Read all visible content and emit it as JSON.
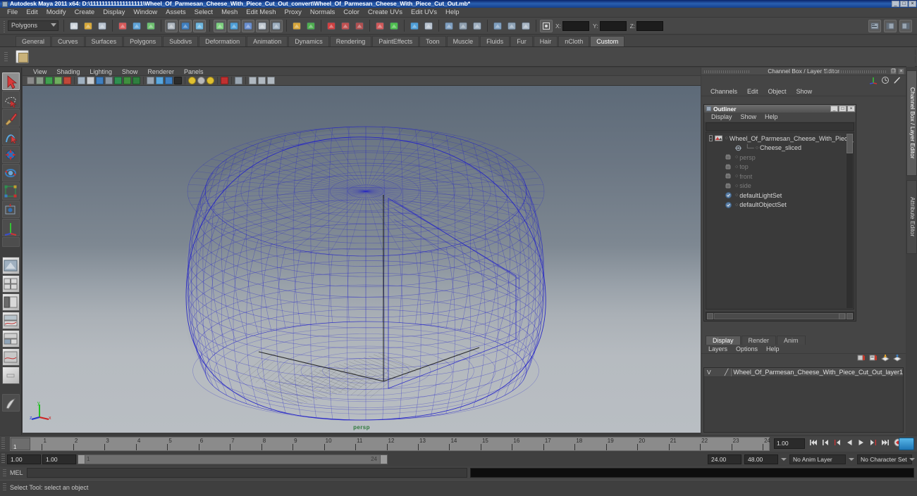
{
  "window": {
    "title": "Autodesk Maya 2011 x64: D:\\111111111111111111\\Wheel_Of_Parmesan_Cheese_With_Piece_Cut_Out_convert\\Wheel_Of_Parmesan_Cheese_With_Piece_Cut_Out.mb*",
    "buttons": [
      "_",
      "□",
      "×"
    ]
  },
  "menubar": {
    "items": [
      "File",
      "Edit",
      "Modify",
      "Create",
      "Display",
      "Window",
      "Assets",
      "Select",
      "Mesh",
      "Edit Mesh",
      "Proxy",
      "Normals",
      "Color",
      "Create UVs",
      "Edit UVs",
      "Help"
    ]
  },
  "toolbar": {
    "mode_menu": "Polygons",
    "coord_labels": [
      "X:",
      "Y:",
      "Z:"
    ],
    "coord_values": [
      "",
      "",
      ""
    ],
    "icons": [
      "new-scene-icon",
      "open-scene-icon",
      "save-scene-icon",
      "undo-icon",
      "redo-icon",
      "redo-all-icon",
      "select-hierarchy-icon",
      "select-by-object-icon",
      "select-by-component-icon",
      "snap-grid-icon",
      "snap-curve-icon",
      "snap-point-icon",
      "snap-view-plane-icon",
      "construction-plane-icon",
      "make-live-icon",
      "render-view-icon",
      "render-current-frame-icon",
      "ipr-render-icon",
      "render-settings-icon",
      "lock-icon",
      "highlight-icon",
      "select-handle-icon",
      "show-manipulator-icon",
      "input-connections-icon",
      "output-connections-icon",
      "no-connections-icon",
      "attribute-editor-icon",
      "channel-box-icon",
      "tool-settings-icon"
    ]
  },
  "shelf": {
    "tabs": [
      "General",
      "Curves",
      "Surfaces",
      "Polygons",
      "Subdivs",
      "Deformation",
      "Animation",
      "Dynamics",
      "Rendering",
      "PaintEffects",
      "Toon",
      "Muscle",
      "Fluids",
      "Fur",
      "Hair",
      "nCloth",
      "Custom"
    ],
    "active_tab": "Custom"
  },
  "viewport": {
    "menu": [
      "View",
      "Shading",
      "Lighting",
      "Show",
      "Renderer",
      "Panels"
    ],
    "camera_label": "persp",
    "axis_labels": {
      "x": "x",
      "y": "y",
      "z": "z"
    },
    "toolbar_icons": [
      "select-camera-icon",
      "lock-camera-icon",
      "image-plane-icon",
      "bookmark-icon",
      "exposure-icon",
      "wireframe-icon",
      "smooth-shade-all-icon",
      "smooth-shade-selected-icon",
      "flat-shade-icon",
      "shaded-wireframe-icon",
      "textured-icon",
      "lighting-icon",
      "use-default-light-icon",
      "use-all-lights-icon",
      "shadows-icon",
      "occlusion-icon",
      "light1-icon",
      "light2-icon",
      "light3-icon",
      "xray-icon",
      "isolate-select-icon",
      "grid-icon",
      "panel-layout-icon",
      "hud-icon"
    ]
  },
  "toolbox": {
    "tools": [
      "select-tool",
      "lasso-select-tool",
      "paint-select-tool",
      "soft-select-tool",
      "move-tool",
      "rotate-tool",
      "scale-tool",
      "universal-manipulator-tool",
      "show-manipulator-tool",
      "last-tool-used",
      "layout-single-perspective",
      "layout-four-view",
      "layout-persp-outliner",
      "layout-persp-graph",
      "layout-persp-hypershade",
      "layout-two-pane",
      "layout-custom",
      "paint-effects-tool"
    ]
  },
  "channel_box": {
    "title": "Channel Box / Layer Editor",
    "title_buttons": [
      "❐",
      "×"
    ],
    "menu": [
      "Channels",
      "Edit",
      "Object",
      "Show"
    ],
    "right_icons": [
      "show-manipulators-icon",
      "clock-icon",
      "pencil-icon"
    ]
  },
  "outliner": {
    "title": "Outliner",
    "title_buttons": [
      "_",
      "□",
      "×"
    ],
    "menu": [
      "Display",
      "Show",
      "Help"
    ],
    "search_value": "",
    "items": [
      {
        "label": "Wheel_Of_Parmesan_Cheese_With_Piece_Cut_O",
        "icon": "transform-node-icon",
        "indent": 0,
        "dim": false,
        "expandable": true
      },
      {
        "label": "Cheese_sliced",
        "icon": "mesh-node-icon",
        "indent": 1,
        "dim": false,
        "expandable": false
      },
      {
        "label": "persp",
        "icon": "camera-icon",
        "indent": 0,
        "dim": true,
        "expandable": false
      },
      {
        "label": "top",
        "icon": "camera-icon",
        "indent": 0,
        "dim": true,
        "expandable": false
      },
      {
        "label": "front",
        "icon": "camera-icon",
        "indent": 0,
        "dim": true,
        "expandable": false
      },
      {
        "label": "side",
        "icon": "camera-icon",
        "indent": 0,
        "dim": true,
        "expandable": false
      },
      {
        "label": "defaultLightSet",
        "icon": "set-icon",
        "indent": 0,
        "dim": false,
        "expandable": false
      },
      {
        "label": "defaultObjectSet",
        "icon": "set-icon",
        "indent": 0,
        "dim": false,
        "expandable": false
      }
    ]
  },
  "layer_editor": {
    "tabs": [
      "Display",
      "Render",
      "Anim"
    ],
    "active_tab": "Display",
    "menu": [
      "Layers",
      "Options",
      "Help"
    ],
    "toolbar_icons": [
      "new-layer-icon",
      "new-layer-from-selected-icon",
      "layer-up-icon",
      "layer-down-icon"
    ],
    "layers": [
      {
        "visibility": "V",
        "type": "",
        "name": "Wheel_Of_Parmesan_Cheese_With_Piece_Cut_Out_layer1"
      }
    ]
  },
  "right_tabs": {
    "items": [
      "Channel Box / Layer Editor",
      "Attribute Editor"
    ],
    "active": "Channel Box / Layer Editor"
  },
  "time_slider": {
    "ticks": [
      "1",
      "2",
      "3",
      "4",
      "5",
      "6",
      "7",
      "8",
      "9",
      "10",
      "11",
      "12",
      "13",
      "14",
      "15",
      "16",
      "17",
      "18",
      "19",
      "20",
      "21",
      "22",
      "23",
      "24"
    ],
    "current_frame": "1",
    "current_field": "1.00",
    "playback_buttons": [
      "go-to-start-icon",
      "step-back-frame-icon",
      "step-back-key-icon",
      "play-backwards-icon",
      "play-forwards-icon",
      "step-forward-key-icon",
      "go-to-end-icon",
      "auto-key-icon"
    ]
  },
  "range_slider": {
    "anim_start": "1.00",
    "range_start": "1.00",
    "range_bar_start": "1",
    "range_bar_end": "24",
    "range_end": "24.00",
    "anim_end": "48.00",
    "anim_layer": "No Anim Layer",
    "character_set": "No Character Set"
  },
  "command_line": {
    "label": "MEL",
    "input_value": "",
    "output_value": ""
  },
  "status_line": {
    "text": "Select Tool: select an object"
  },
  "colors": {
    "title_bar": "#1b4b9e",
    "panel_bg": "#454545",
    "wireframe": "#2222cc",
    "persp_label": "#2f7a3e",
    "accent_blue": "#3fa3dd"
  }
}
